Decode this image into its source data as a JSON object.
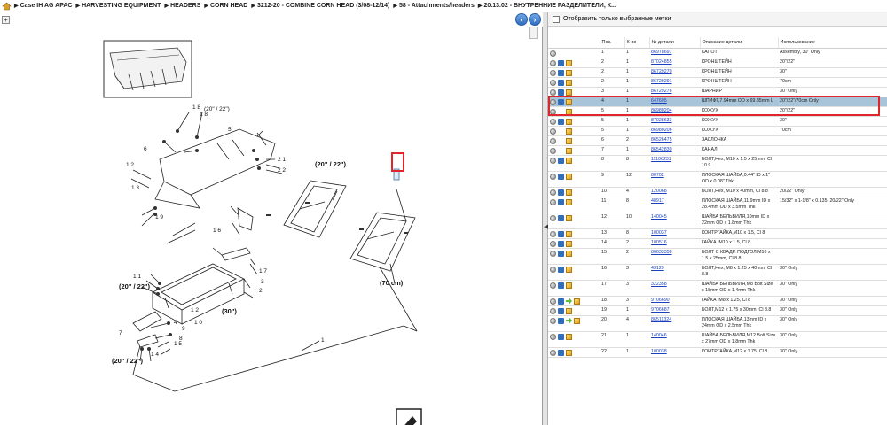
{
  "breadcrumb": {
    "items": [
      "Case IH AG APAC",
      "HARVESTING EQUIPMENT",
      "HEADERS",
      "CORN HEAD",
      "3212-20 - COMBINE CORN HEAD (3/08-12/14)",
      "58 - Attachments/headers",
      "20.13.02 - ВНУТРЕННИЕ РАЗДЕЛИТЕЛИ, К..."
    ]
  },
  "diagram": {
    "labels": {
      "l20_22_top": "(20\" / 22\")",
      "l20_22_mid": "(20\" / 22\")",
      "l20_22_left": "(20\" / 22\")",
      "l20_22_bot": "(20\" / 22\")",
      "l30": "(30\")",
      "l70": "(70 cm)",
      "n18a": "1 8",
      "n18b": "1 8",
      "n5": "5",
      "n6": "6",
      "n21": "2 1",
      "n22": "2 2",
      "n12a": "1 2",
      "n13": "1 3",
      "n19": "1 9",
      "n16": "1 6",
      "n3": "3",
      "n7": "7",
      "n2": "2",
      "n4": "4",
      "n11": "1 1",
      "n17": "1 7",
      "n10": "1 0",
      "n9": "9",
      "n8": "8",
      "n14": "1 4",
      "n15": "1 5",
      "n12b": "1 2",
      "n1": "1"
    }
  },
  "filter": {
    "label": "Отобразить только выбранные метки"
  },
  "table": {
    "headers": [
      "Поз.",
      "К-во",
      "№ детали",
      "Описание детали",
      "Использование"
    ],
    "rows": [
      {
        "icons": [
          "circle"
        ],
        "pos": "1",
        "qty": "1",
        "part": "86978697",
        "desc": "КАПОТ",
        "usage": "Assembly, 30\" Only"
      },
      {
        "icons": [
          "circle",
          "book",
          "box"
        ],
        "pos": "2",
        "qty": "1",
        "part": "87024855",
        "desc": "КРОНШТЕЙН",
        "usage": "20\"/22\""
      },
      {
        "icons": [
          "circle",
          "book",
          "box"
        ],
        "pos": "2",
        "qty": "1",
        "part": "86729270",
        "desc": "КРОНШТЕЙН",
        "usage": "30\""
      },
      {
        "icons": [
          "circle",
          "book",
          "box"
        ],
        "pos": "2",
        "qty": "1",
        "part": "86729291",
        "desc": "КРОНШТЕЙН",
        "usage": "70cm"
      },
      {
        "icons": [
          "circle",
          "book",
          "box"
        ],
        "pos": "3",
        "qty": "1",
        "part": "86729276",
        "desc": "ШАРНИР",
        "usage": "30\" Only"
      },
      {
        "icons": [
          "circle",
          "book",
          "box"
        ],
        "pos": "4",
        "qty": "1",
        "part": "647695",
        "desc": "ШПИФТ,7.94mm OD x 69.85mm L",
        "usage": "20\"/22\"/70cm Only",
        "selected": true
      },
      {
        "icons": [
          "circle",
          "box"
        ],
        "pos": "5",
        "qty": "1",
        "part": "86980204",
        "desc": "КОЖУХ",
        "usage": "20\"/22\""
      },
      {
        "icons": [
          "circle",
          "book",
          "box"
        ],
        "pos": "5",
        "qty": "1",
        "part": "87028633",
        "desc": "КОЖУХ",
        "usage": "30\""
      },
      {
        "icons": [
          "circle",
          "box"
        ],
        "pos": "5",
        "qty": "1",
        "part": "86980206",
        "desc": "КОЖУХ",
        "usage": "70cm"
      },
      {
        "icons": [
          "circle",
          "box"
        ],
        "pos": "6",
        "qty": "2",
        "part": "86526475",
        "desc": "ЗАСЛОНКА",
        "usage": ""
      },
      {
        "icons": [
          "circle",
          "box"
        ],
        "pos": "7",
        "qty": "1",
        "part": "86542830",
        "desc": "КАНАЛ",
        "usage": ""
      },
      {
        "icons": [
          "circle",
          "book",
          "box"
        ],
        "pos": "8",
        "qty": "8",
        "part": "11106231",
        "desc": "БОЛТ,Hex, M10 x 1.5 x 25mm, Cl 10.9",
        "usage": ""
      },
      {
        "icons": [
          "circle",
          "book",
          "box"
        ],
        "pos": "9",
        "qty": "12",
        "part": "80702",
        "desc": "ПЛОСКАЯ ШАЙБА,0.44\" ID x 1\" OD x 0.08\" Thk",
        "usage": ""
      },
      {
        "icons": [
          "circle",
          "book",
          "box"
        ],
        "pos": "10",
        "qty": "4",
        "part": "120068",
        "desc": "БОЛТ,Hex, M10 x 40mm, Cl 8.8",
        "usage": "20/22\" Only"
      },
      {
        "icons": [
          "circle",
          "book",
          "box"
        ],
        "pos": "11",
        "qty": "8",
        "part": "48917",
        "desc": "ПЛОСКАЯ ШАЙБА,11.9mm ID x 28.4mm OD x 3.5mm Thk",
        "usage": "15/32\" x 1-1/8\" x 0.135, 20/22\" Only"
      },
      {
        "icons": [
          "circle",
          "book",
          "box"
        ],
        "pos": "12",
        "qty": "10",
        "part": "140045",
        "desc": "ШАЙБА БЕЛЬВИЛЯ,10mm ID x 22mm OD x 1.8mm Thk",
        "usage": ""
      },
      {
        "icons": [
          "circle",
          "book",
          "box"
        ],
        "pos": "13",
        "qty": "8",
        "part": "100037",
        "desc": "КОНТРГАЙКА,M10 x 1.5, Cl 8",
        "usage": ""
      },
      {
        "icons": [
          "circle",
          "book",
          "box"
        ],
        "pos": "14",
        "qty": "2",
        "part": "100516",
        "desc": "ГАЙКА ,M10 x 1.5, Cl 8",
        "usage": ""
      },
      {
        "icons": [
          "circle",
          "book",
          "box"
        ],
        "pos": "15",
        "qty": "2",
        "part": "86633358",
        "desc": "БОЛТ С КВАДР. ПОДГОЛ,M10 x 1.5 x 25mm, Cl 8.8",
        "usage": ""
      },
      {
        "icons": [
          "circle",
          "book",
          "box"
        ],
        "pos": "16",
        "qty": "3",
        "part": "43129",
        "desc": "БОЛТ,Hex, M8 x 1.25 x 40mm, Cl 8.8",
        "usage": "30\" Only"
      },
      {
        "icons": [
          "circle",
          "book",
          "box"
        ],
        "pos": "17",
        "qty": "3",
        "part": "322358",
        "desc": "ШАЙБА БЕЛЬВИЛЯ,M8 Bolt Size x 18mm OD x 1.4mm Thk",
        "usage": "30\" Only"
      },
      {
        "icons": [
          "circle",
          "book",
          "arrow",
          "box"
        ],
        "pos": "18",
        "qty": "3",
        "part": "9706690",
        "desc": "ГАЙКА ,M8 x 1.25, Cl 8",
        "usage": "30\" Only"
      },
      {
        "icons": [
          "circle",
          "book",
          "box"
        ],
        "pos": "19",
        "qty": "1",
        "part": "9706687",
        "desc": "БОЛТ,M12 x 1.75 x 30mm, Cl 8.8",
        "usage": "30\" Only"
      },
      {
        "icons": [
          "circle",
          "book",
          "arrow",
          "box"
        ],
        "pos": "20",
        "qty": "4",
        "part": "86511324",
        "desc": "ПЛОСКАЯ ШАЙБА,13mm ID x 24mm OD x 2.5mm Thk",
        "usage": "30\" Only"
      },
      {
        "icons": [
          "circle",
          "book",
          "box"
        ],
        "pos": "21",
        "qty": "1",
        "part": "140046",
        "desc": "ШАЙБА БЕЛЬВИЛЯ,M12 Bolt Size x 27mm OD x 1.8mm Thk",
        "usage": "30\" Only"
      },
      {
        "icons": [
          "circle",
          "book",
          "box"
        ],
        "pos": "22",
        "qty": "1",
        "part": "100038",
        "desc": "КОНТРГАЙКА,M12 x 1.75, Cl 8",
        "usage": "30\" Only"
      }
    ]
  },
  "icon_names": {
    "circle": "gray-circle-icon",
    "book": "blue-book-icon",
    "arrow": "green-arrow-icon",
    "box": "yellow-box-icon"
  },
  "colors": {
    "selected_row": "#a8c4d8",
    "highlight_border": "#e0262c",
    "link": "#1a3fbf"
  }
}
